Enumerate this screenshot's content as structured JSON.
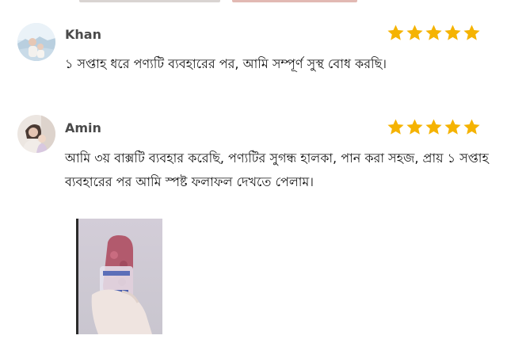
{
  "colors": {
    "star": "#f5b301",
    "name": "#4a4a4a",
    "text": "#111111"
  },
  "reviews": [
    {
      "author": "Khan",
      "avatar_icon": "avatar-photo-icon",
      "rating": 5,
      "text": "১ সপ্তাহ ধরে পণ্যটি ব্যবহারের পর, আমি সম্পূর্ণ সুস্থ বোধ করছি।"
    },
    {
      "author": "Amin",
      "avatar_icon": "avatar-photo-icon",
      "rating": 5,
      "text": "আমি ৩য় বাক্সটি ব্যবহার করেছি, পণ্যটির সুগন্ধ হালকা, পান করা সহজ, প্রায় ১ সপ্তাহ ব্যবহারের পর আমি স্পষ্ট ফলাফল দেখতে পেলাম।"
    }
  ]
}
